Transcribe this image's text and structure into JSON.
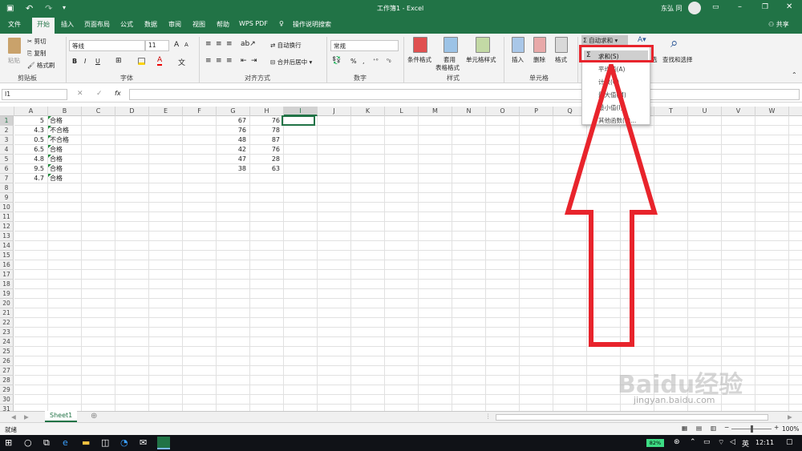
{
  "title": "工作簿1 - Excel",
  "user": "东弘 同",
  "tabs": [
    "文件",
    "开始",
    "插入",
    "页面布局",
    "公式",
    "数据",
    "审阅",
    "视图",
    "帮助",
    "WPS PDF",
    "操作说明搜索"
  ],
  "share": "共享",
  "clipboard": {
    "paste": "粘贴",
    "cut": "剪切",
    "copy": "复制",
    "format_painter": "格式刷",
    "label": "剪贴板"
  },
  "font": {
    "name": "等线",
    "size": "11",
    "label": "字体",
    "bold": "B",
    "italic": "I",
    "underline": "U"
  },
  "align": {
    "wrap": "自动换行",
    "merge": "合并后居中",
    "label": "对齐方式"
  },
  "number": {
    "format": "常规",
    "label": "数字",
    "percent": "%",
    "comma": ","
  },
  "styles": {
    "cond": "条件格式",
    "table1": "套用",
    "table2": "表格格式",
    "cell": "单元格样式",
    "label": "样式"
  },
  "cells": {
    "insert": "插入",
    "delete": "删除",
    "format": "格式",
    "label": "单元格"
  },
  "editing": {
    "autosum": "自动求和",
    "sort": "选",
    "find": "查找和选择"
  },
  "namebox": "I1",
  "fx": "fx",
  "columns": [
    "A",
    "B",
    "C",
    "D",
    "E",
    "F",
    "G",
    "H",
    "I",
    "J",
    "K",
    "L",
    "M",
    "N",
    "O",
    "P",
    "Q",
    "R",
    "S",
    "T",
    "U",
    "V",
    "W"
  ],
  "rows": [
    "1",
    "2",
    "3",
    "4",
    "5",
    "6",
    "7",
    "8",
    "9",
    "10",
    "11",
    "12",
    "13",
    "14",
    "15",
    "16",
    "17",
    "18",
    "19",
    "20",
    "21",
    "22",
    "23",
    "24",
    "25",
    "26",
    "27",
    "28",
    "29",
    "30",
    "31"
  ],
  "data": [
    {
      "a": "5",
      "b": "合格",
      "g": "67",
      "h": "76"
    },
    {
      "a": "4.3",
      "b": "不合格",
      "g": "76",
      "h": "78"
    },
    {
      "a": "0.5",
      "b": "不合格",
      "g": "48",
      "h": "87"
    },
    {
      "a": "6.5",
      "b": "合格",
      "g": "42",
      "h": "76"
    },
    {
      "a": "4.8",
      "b": "合格",
      "g": "47",
      "h": "28"
    },
    {
      "a": "9.5",
      "b": "合格",
      "g": "38",
      "h": "63"
    },
    {
      "a": "4.7",
      "b": "合格",
      "g": "",
      "h": ""
    }
  ],
  "dropdown": [
    "求和(S)",
    "平均值(A)",
    "计数(C)",
    "最大值(M)",
    "最小值(I)",
    "其他函数(F)..."
  ],
  "sheet_tab": "Sheet1",
  "status": "就绪",
  "zoom": "100%",
  "taskbar": {
    "battery": "82%",
    "ime": "英",
    "time": "12:11"
  },
  "watermark": {
    "brand": "Baidu经验",
    "url": "jingyan.baidu.com"
  },
  "colors": {
    "excel_green": "#217346",
    "red_highlight": "#e8242c"
  }
}
